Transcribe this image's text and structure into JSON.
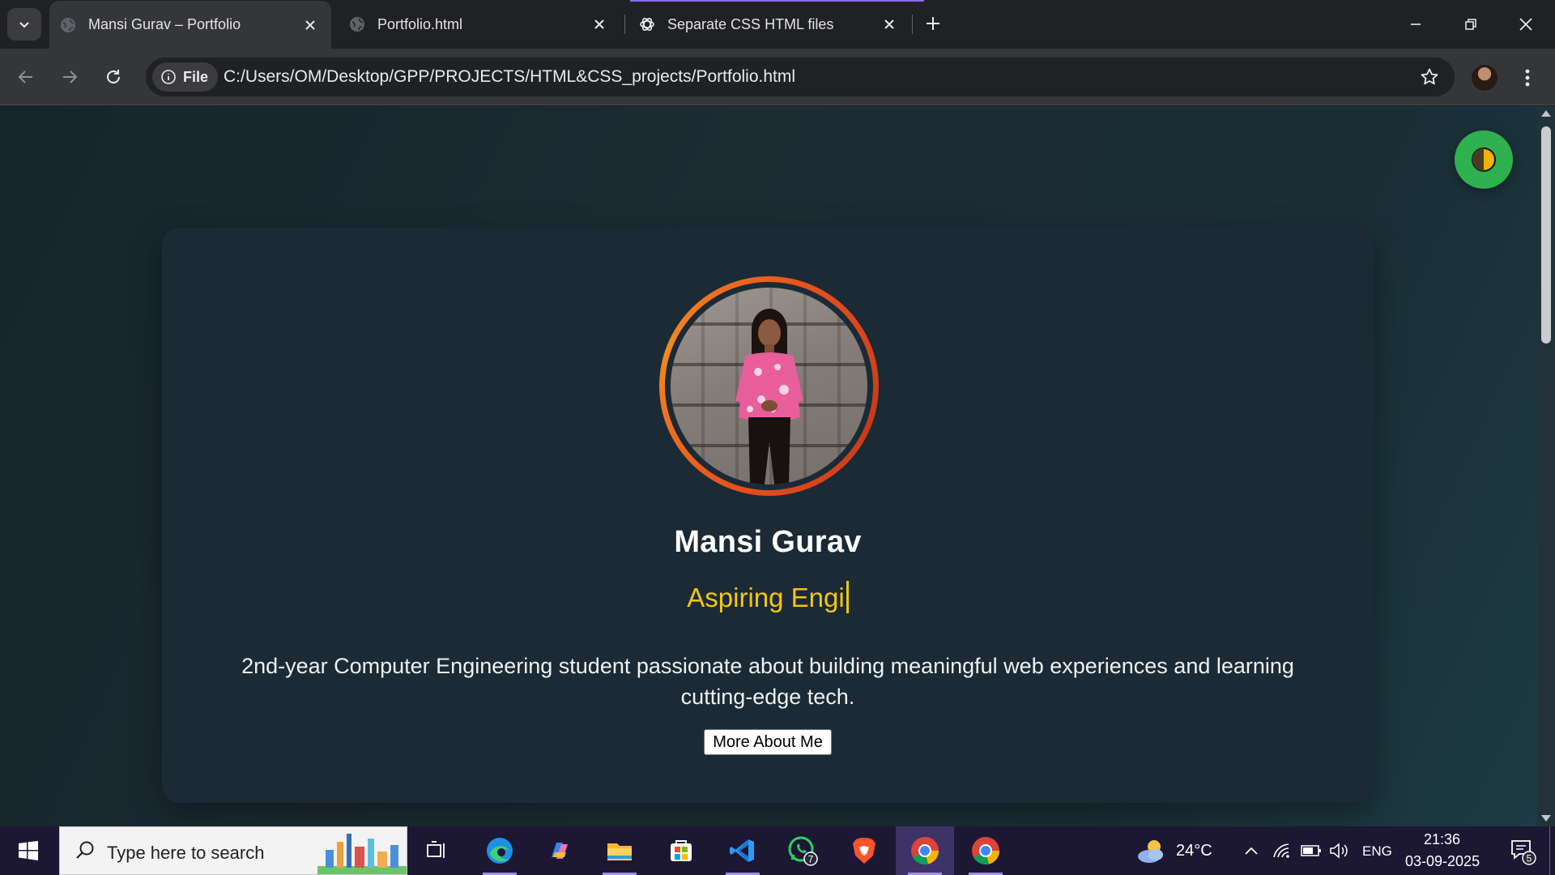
{
  "browser": {
    "tabs": [
      {
        "title": "Mansi Gurav – Portfolio",
        "active": true
      },
      {
        "title": "Portfolio.html",
        "active": false
      },
      {
        "title": "Separate CSS HTML files",
        "active": false
      }
    ],
    "address": {
      "chip_label": "File",
      "url": "C:/Users/OM/Desktop/GPP/PROJECTS/HTML&CSS_projects/Portfolio.html"
    },
    "colors": {
      "tab_indicator": "#8a6cf0",
      "accent": "#2fb14f"
    }
  },
  "page": {
    "name": "Mansi Gurav",
    "typed_role": "Aspiring Engi",
    "bio": "2nd-year Computer Engineering student passionate about building meaningful web experiences and learning cutting-edge tech.",
    "more_button": "More About Me",
    "colors": {
      "name": "#ffffff",
      "role": "#f3c614",
      "ring": "#e8501e",
      "toggle": "#2fb14f"
    }
  },
  "taskbar": {
    "search_placeholder": "Type here to search",
    "whatsapp_badge": "7",
    "weather": {
      "temp": "24°C"
    },
    "language": "ENG",
    "time": "21:36",
    "date": "03-09-2025",
    "notifications": "5"
  }
}
